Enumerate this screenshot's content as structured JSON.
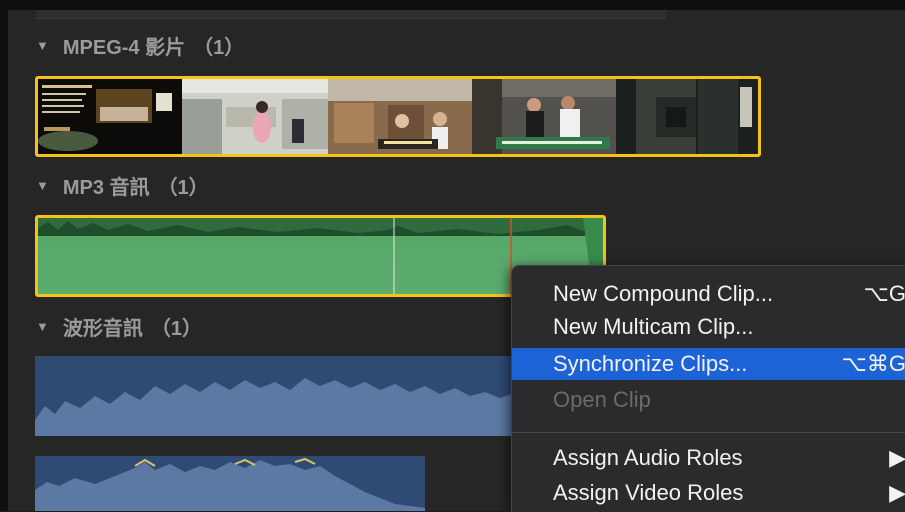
{
  "groups": [
    {
      "title": "MPEG-4 影片",
      "count": "（1）"
    },
    {
      "title": "MP3 音訊",
      "count": "（1）"
    },
    {
      "title": "波形音訊",
      "count": "（1）"
    }
  ],
  "menu": {
    "items": [
      {
        "label": "New Compound Clip...",
        "shortcut": "⌥G"
      },
      {
        "label": "New Multicam Clip...",
        "shortcut": ""
      },
      {
        "label": "Synchronize Clips...",
        "shortcut": "⌥⌘G"
      },
      {
        "label": "Open Clip",
        "shortcut": ""
      },
      {
        "label": "Assign Audio Roles",
        "shortcut": "▶"
      },
      {
        "label": "Assign Video Roles",
        "shortcut": "▶"
      }
    ]
  },
  "colors": {
    "selection": "#f4c316",
    "menu_highlight": "#1d63d8",
    "audio_green": "#5bab6d",
    "audio_blue": "#3e5b86"
  }
}
